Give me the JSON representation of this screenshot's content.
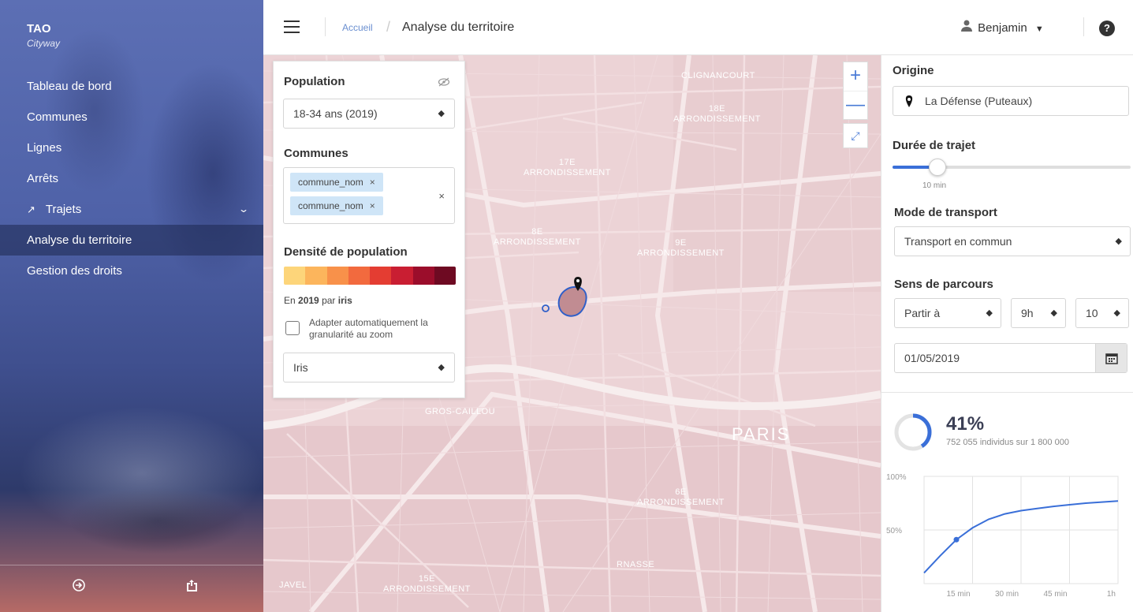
{
  "sidebar": {
    "brand": "TAO",
    "brand_sub": "Cityway",
    "items": [
      {
        "label": "Tableau de bord"
      },
      {
        "label": "Communes"
      },
      {
        "label": "Lignes"
      },
      {
        "label": "Arrêts"
      },
      {
        "label": "Trajets",
        "icon": "route-icon",
        "expandable": true
      },
      {
        "label": "Analyse du territoire",
        "active": true
      },
      {
        "label": "Gestion des droits"
      }
    ],
    "footer": {
      "logout_icon": "logout-icon",
      "exit_icon": "exit-icon"
    }
  },
  "topbar": {
    "breadcrumb_home": "Accueil",
    "breadcrumb_current": "Analyse du territoire",
    "user_name": "Benjamin",
    "help": "?"
  },
  "map": {
    "labels": {
      "clignancourt": "CLIGNANCOURT",
      "arr18": "18E\nARRONDISSEMENT",
      "arr17": "17E\nARRONDISSEMENT",
      "arr8": "8E\nARRONDISSEMENT",
      "arr9": "9E\nARRONDISSEMENT",
      "gros_caillou": "GROS-CAILLOU",
      "paris": "PARIS",
      "arr6": "6E\nARRONDISSEMENT",
      "nasse": "RNASSE",
      "javel": "JAVEL",
      "arr15": "15E\nARRONDISSEMENT"
    },
    "zoom_in": "+",
    "zoom_out": "—",
    "fullscreen": "⤢"
  },
  "layers": {
    "population_title": "Population",
    "population_select": "18-34 ans (2019)",
    "communes_title": "Communes",
    "communes_tags": [
      "commune_nom",
      "commune_nom"
    ],
    "density_title": "Densité de population",
    "density_colors": [
      "#fdd57a",
      "#fcb55c",
      "#f8914a",
      "#f26a3e",
      "#e43d32",
      "#c91e32",
      "#9b0d2b",
      "#6e0a22"
    ],
    "note_prefix": "En",
    "note_year": "2019",
    "note_mid": "par",
    "note_unit": "iris",
    "auto_granularity": "Adapter automatiquement la granularité au zoom",
    "granularity_select": "Iris"
  },
  "trip": {
    "origin_label": "Origine",
    "origin_value": "La Défense (Puteaux)",
    "duration_label": "Durée de trajet",
    "duration_value": "10 min",
    "duration_fraction": 0.19,
    "mode_label": "Mode de transport",
    "mode_value": "Transport en commun",
    "direction_label": "Sens de parcours",
    "direction_value": "Partir à",
    "hour_value": "9h",
    "minute_value": "10",
    "date_value": "01/05/2019"
  },
  "stats": {
    "percent": "41%",
    "percent_fraction": 0.41,
    "detail": "752 055 individus sur 1 800 000"
  },
  "chart_data": {
    "type": "line",
    "x": [
      0,
      5,
      10,
      15,
      20,
      25,
      30,
      35,
      40,
      45,
      50,
      55,
      60
    ],
    "y": [
      10,
      26,
      41,
      52,
      60,
      65,
      68,
      70,
      72,
      73.5,
      75,
      76,
      77
    ],
    "highlight_x": 10,
    "xticks": [
      15,
      30,
      45,
      60
    ],
    "xtick_labels": [
      "15 min",
      "30 min",
      "45 min",
      "1h"
    ],
    "yticks": [
      50,
      100
    ],
    "ytick_labels": [
      "50%",
      "100%"
    ],
    "xlim": [
      0,
      60
    ],
    "ylim": [
      0,
      100
    ],
    "grid": true,
    "color": "#3a6fd8"
  }
}
